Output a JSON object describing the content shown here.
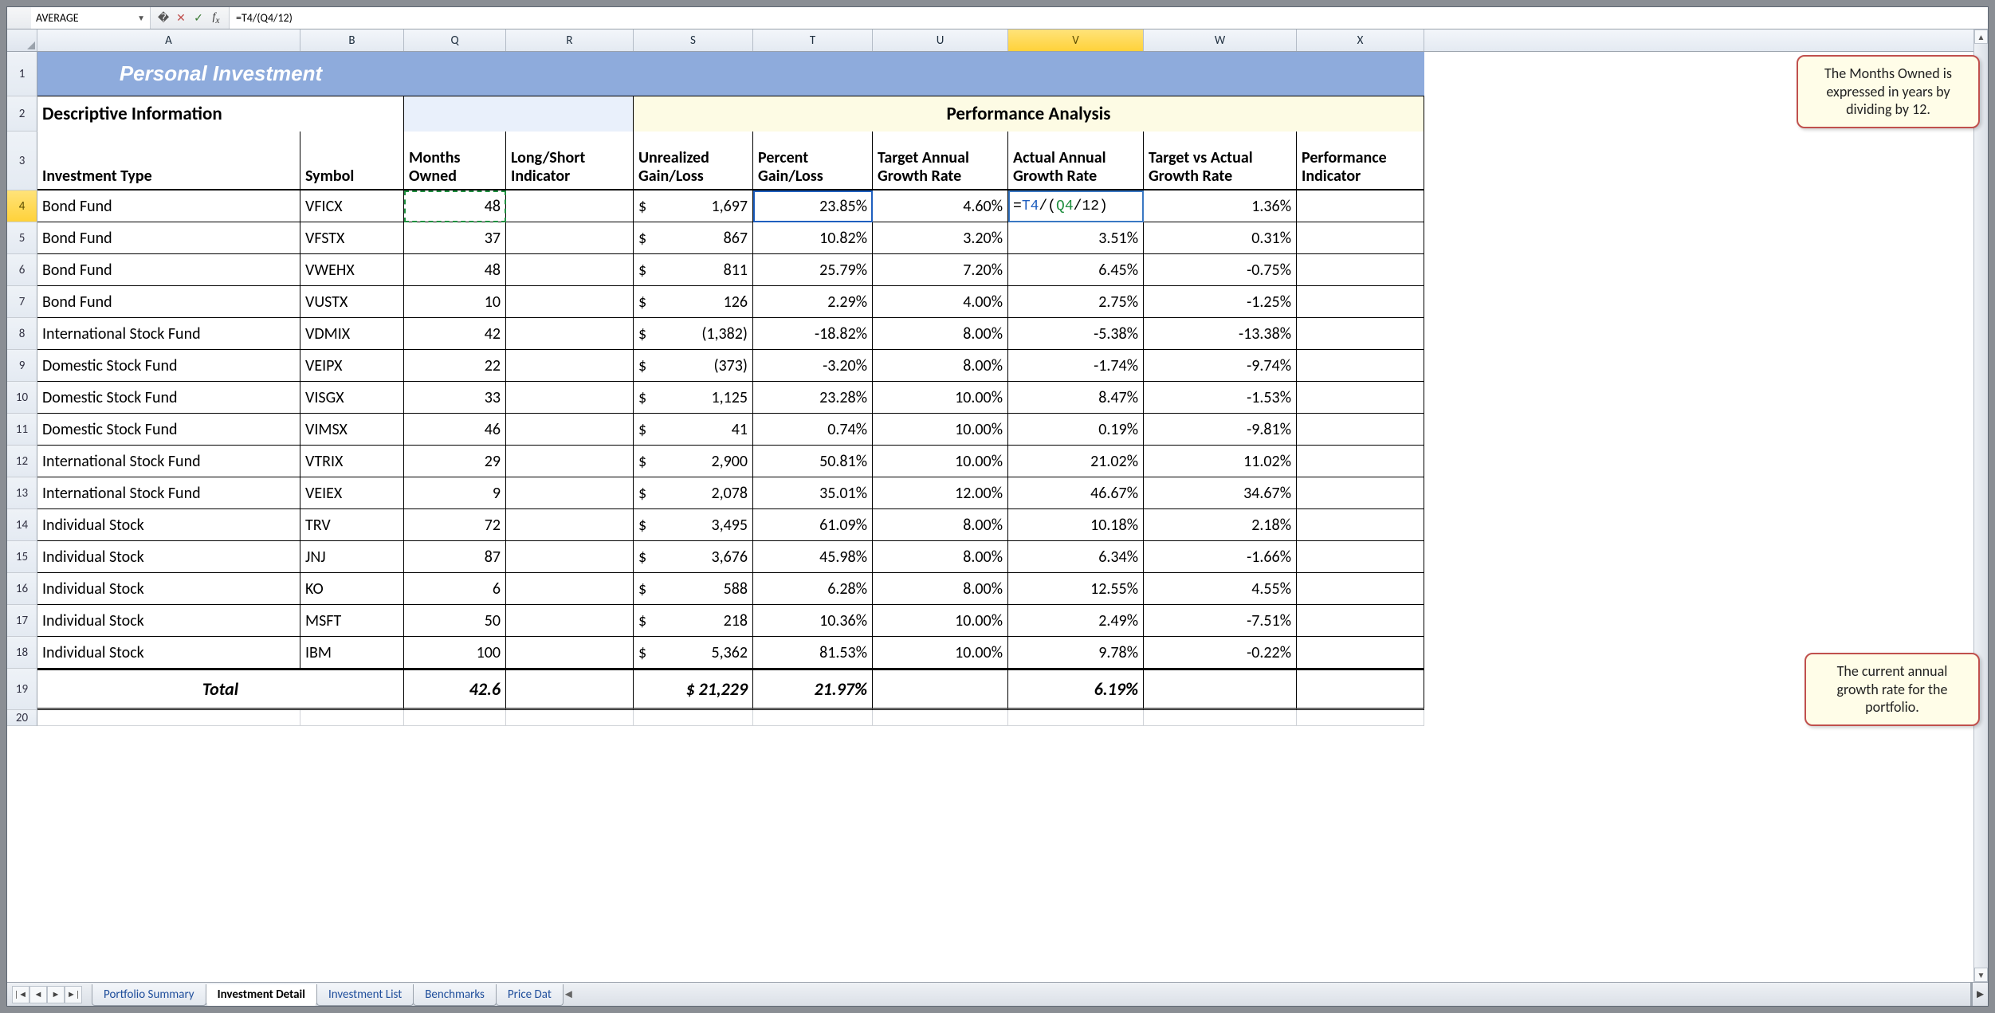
{
  "name_box": "AVERAGE",
  "formula": "=T4/(Q4/12)",
  "formula_parts": {
    "pre": "=",
    "r1": "T4",
    "mid": "/(",
    "r2": "Q4",
    "post": "/12)"
  },
  "columns": [
    "A",
    "B",
    "Q",
    "R",
    "S",
    "T",
    "U",
    "V",
    "W",
    "X"
  ],
  "selected_column": "V",
  "selected_row": "4",
  "banner": "Personal Investment",
  "section_left": "Descriptive Information",
  "section_right": "Performance Analysis",
  "headers": {
    "A": "Investment Type",
    "B": "Symbol",
    "Q": "Months Owned",
    "R": "Long/Short Indicator",
    "S": "Unrealized Gain/Loss",
    "T": "Percent Gain/Loss",
    "U": "Target Annual Growth Rate",
    "V": "Actual Annual Growth Rate",
    "W": "Target vs Actual Growth Rate",
    "X": "Performance Indicator"
  },
  "rows": [
    {
      "n": "4",
      "A": "Bond Fund",
      "B": "VFICX",
      "Q": "48",
      "R": "",
      "S": "1,697",
      "T": "23.85%",
      "U": "4.60%",
      "V_edit": true,
      "W": "1.36%",
      "X": ""
    },
    {
      "n": "5",
      "A": "Bond Fund",
      "B": "VFSTX",
      "Q": "37",
      "R": "",
      "S": "867",
      "T": "10.82%",
      "U": "3.20%",
      "V": "3.51%",
      "W": "0.31%",
      "X": ""
    },
    {
      "n": "6",
      "A": "Bond Fund",
      "B": "VWEHX",
      "Q": "48",
      "R": "",
      "S": "811",
      "T": "25.79%",
      "U": "7.20%",
      "V": "6.45%",
      "W": "-0.75%",
      "X": ""
    },
    {
      "n": "7",
      "A": "Bond Fund",
      "B": "VUSTX",
      "Q": "10",
      "R": "",
      "S": "126",
      "T": "2.29%",
      "U": "4.00%",
      "V": "2.75%",
      "W": "-1.25%",
      "X": ""
    },
    {
      "n": "8",
      "A": "International Stock Fund",
      "B": "VDMIX",
      "Q": "42",
      "R": "",
      "S": "(1,382)",
      "T": "-18.82%",
      "U": "8.00%",
      "V": "-5.38%",
      "W": "-13.38%",
      "X": ""
    },
    {
      "n": "9",
      "A": "Domestic Stock Fund",
      "B": "VEIPX",
      "Q": "22",
      "R": "",
      "S": "(373)",
      "T": "-3.20%",
      "U": "8.00%",
      "V": "-1.74%",
      "W": "-9.74%",
      "X": ""
    },
    {
      "n": "10",
      "A": "Domestic Stock Fund",
      "B": "VISGX",
      "Q": "33",
      "R": "",
      "S": "1,125",
      "T": "23.28%",
      "U": "10.00%",
      "V": "8.47%",
      "W": "-1.53%",
      "X": ""
    },
    {
      "n": "11",
      "A": "Domestic Stock Fund",
      "B": "VIMSX",
      "Q": "46",
      "R": "",
      "S": "41",
      "T": "0.74%",
      "U": "10.00%",
      "V": "0.19%",
      "W": "-9.81%",
      "X": ""
    },
    {
      "n": "12",
      "A": "International Stock Fund",
      "B": "VTRIX",
      "Q": "29",
      "R": "",
      "S": "2,900",
      "T": "50.81%",
      "U": "10.00%",
      "V": "21.02%",
      "W": "11.02%",
      "X": ""
    },
    {
      "n": "13",
      "A": "International Stock Fund",
      "B": "VEIEX",
      "Q": "9",
      "R": "",
      "S": "2,078",
      "T": "35.01%",
      "U": "12.00%",
      "V": "46.67%",
      "W": "34.67%",
      "X": ""
    },
    {
      "n": "14",
      "A": "Individual Stock",
      "B": "TRV",
      "Q": "72",
      "R": "",
      "S": "3,495",
      "T": "61.09%",
      "U": "8.00%",
      "V": "10.18%",
      "W": "2.18%",
      "X": ""
    },
    {
      "n": "15",
      "A": "Individual Stock",
      "B": "JNJ",
      "Q": "87",
      "R": "",
      "S": "3,676",
      "T": "45.98%",
      "U": "8.00%",
      "V": "6.34%",
      "W": "-1.66%",
      "X": ""
    },
    {
      "n": "16",
      "A": "Individual Stock",
      "B": "KO",
      "Q": "6",
      "R": "",
      "S": "588",
      "T": "6.28%",
      "U": "8.00%",
      "V": "12.55%",
      "W": "4.55%",
      "X": ""
    },
    {
      "n": "17",
      "A": "Individual Stock",
      "B": "MSFT",
      "Q": "50",
      "R": "",
      "S": "218",
      "T": "10.36%",
      "U": "10.00%",
      "V": "2.49%",
      "W": "-7.51%",
      "X": ""
    },
    {
      "n": "18",
      "A": "Individual Stock",
      "B": "IBM",
      "Q": "100",
      "R": "",
      "S": "5,362",
      "T": "81.53%",
      "U": "10.00%",
      "V": "9.78%",
      "W": "-0.22%",
      "X": ""
    }
  ],
  "total": {
    "label": "Total",
    "Q": "42.6",
    "S": "$ 21,229",
    "T": "21.97%",
    "V": "6.19%"
  },
  "callouts": {
    "top": "The Months Owned is expressed in years by dividing by 12.",
    "bottom": "The current annual growth rate for the portfolio."
  },
  "tabs": [
    "Portfolio Summary",
    "Investment Detail",
    "Investment List",
    "Benchmarks",
    "Price Dat"
  ],
  "active_tab": 1,
  "chart_data": {
    "type": "table",
    "title": "Personal Investment — Performance Analysis",
    "columns": [
      "Investment Type",
      "Symbol",
      "Months Owned",
      "Unrealized Gain/Loss ($)",
      "Percent Gain/Loss",
      "Target Annual Growth Rate",
      "Actual Annual Growth Rate",
      "Target vs Actual Growth Rate"
    ],
    "rows": [
      [
        "Bond Fund",
        "VFICX",
        48,
        1697,
        23.85,
        4.6,
        null,
        1.36
      ],
      [
        "Bond Fund",
        "VFSTX",
        37,
        867,
        10.82,
        3.2,
        3.51,
        0.31
      ],
      [
        "Bond Fund",
        "VWEHX",
        48,
        811,
        25.79,
        7.2,
        6.45,
        -0.75
      ],
      [
        "Bond Fund",
        "VUSTX",
        10,
        126,
        2.29,
        4.0,
        2.75,
        -1.25
      ],
      [
        "International Stock Fund",
        "VDMIX",
        42,
        -1382,
        -18.82,
        8.0,
        -5.38,
        -13.38
      ],
      [
        "Domestic Stock Fund",
        "VEIPX",
        22,
        -373,
        -3.2,
        8.0,
        -1.74,
        -9.74
      ],
      [
        "Domestic Stock Fund",
        "VISGX",
        33,
        1125,
        23.28,
        10.0,
        8.47,
        -1.53
      ],
      [
        "Domestic Stock Fund",
        "VIMSX",
        46,
        41,
        0.74,
        10.0,
        0.19,
        -9.81
      ],
      [
        "International Stock Fund",
        "VTRIX",
        29,
        2900,
        50.81,
        10.0,
        21.02,
        11.02
      ],
      [
        "International Stock Fund",
        "VEIEX",
        9,
        2078,
        35.01,
        12.0,
        46.67,
        34.67
      ],
      [
        "Individual Stock",
        "TRV",
        72,
        3495,
        61.09,
        8.0,
        10.18,
        2.18
      ],
      [
        "Individual Stock",
        "JNJ",
        87,
        3676,
        45.98,
        8.0,
        6.34,
        -1.66
      ],
      [
        "Individual Stock",
        "KO",
        6,
        588,
        6.28,
        8.0,
        12.55,
        4.55
      ],
      [
        "Individual Stock",
        "MSFT",
        50,
        218,
        10.36,
        10.0,
        2.49,
        -7.51
      ],
      [
        "Individual Stock",
        "IBM",
        100,
        5362,
        81.53,
        10.0,
        9.78,
        -0.22
      ]
    ],
    "totals": {
      "Months Owned": 42.6,
      "Unrealized Gain/Loss ($)": 21229,
      "Percent Gain/Loss": 21.97,
      "Actual Annual Growth Rate": 6.19
    }
  }
}
